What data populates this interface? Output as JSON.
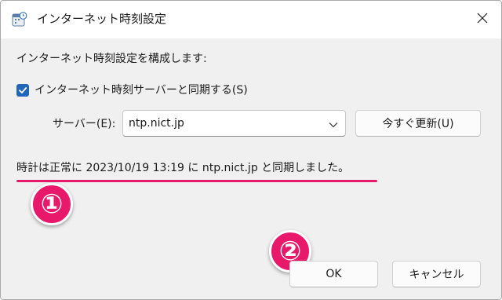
{
  "window": {
    "title": "インターネット時刻設定",
    "title_icon": "clock-calendar-icon",
    "close_icon": "close-icon"
  },
  "content": {
    "configure_label": "インターネット時刻設定を構成します:",
    "sync_checkbox": {
      "label": "インターネット時刻サーバーと同期する(S)",
      "checked": true,
      "accent_color": "#2266b8"
    },
    "server": {
      "label": "サーバー(E):",
      "value": "ntp.nict.jp",
      "dropdown_icon": "chevron-down-icon"
    },
    "update_button_label": "今すぐ更新(U)",
    "status_text": "時計は正常に 2023/10/19 13:19 に ntp.nict.jp と同期しました。"
  },
  "footer": {
    "ok_label": "OK",
    "cancel_label": "キャンセル"
  },
  "annotations": {
    "badge_1": "①",
    "badge_2": "②",
    "highlight_color": "#e8196a"
  }
}
